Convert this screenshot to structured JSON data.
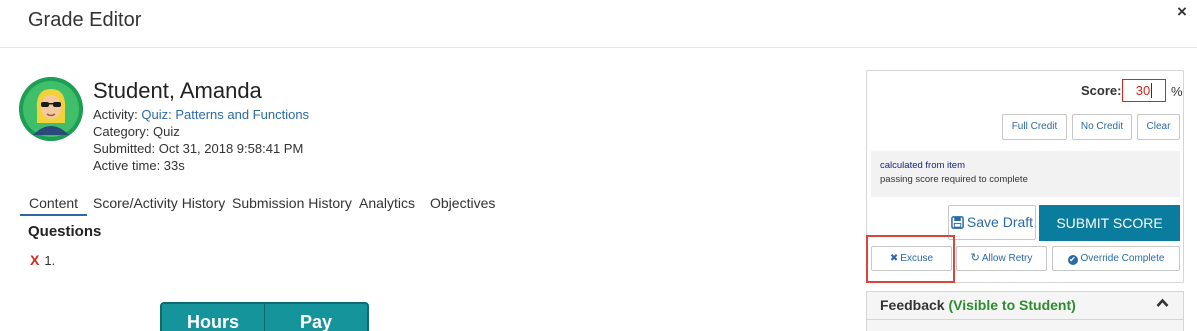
{
  "modal": {
    "title": "Grade Editor",
    "close_glyph": "×"
  },
  "student": {
    "name": "Student, Amanda",
    "activity_label": "Activity: ",
    "activity_link": "Quiz: Patterns and Functions",
    "category": "Category: Quiz",
    "submitted": "Submitted: Oct 31, 2018 9:58:41 PM",
    "active_time": "Active time: 33s"
  },
  "tabs": [
    {
      "label": "Content",
      "active": true
    },
    {
      "label": "Score/Activity History",
      "active": false
    },
    {
      "label": "Submission History",
      "active": false
    },
    {
      "label": "Analytics",
      "active": false
    },
    {
      "label": "Objectives",
      "active": false
    }
  ],
  "content": {
    "questions_title": "Questions",
    "question_mark": "X",
    "question_number": "1.",
    "table_headers": [
      "Hours",
      "Pay"
    ]
  },
  "score_panel": {
    "score_label": "Score:",
    "score_value": "30",
    "percent_sign": "%",
    "full_credit": "Full Credit",
    "no_credit": "No Credit",
    "clear": "Clear",
    "info_line1": "calculated from item",
    "info_line2": "passing score required to complete",
    "save_draft": "Save Draft",
    "submit_score": "SUBMIT SCORE",
    "excuse": "Excuse",
    "allow_retry": "Allow Retry",
    "override_complete": "Override Complete"
  },
  "feedback": {
    "title": "Feedback",
    "visibility": "(Visible to Student)"
  },
  "colors": {
    "link": "#2b6aa6",
    "submit_bg": "#0a7d9e",
    "error_red": "#d9261c",
    "avatar_green": "#1e9e54",
    "table_teal": "#16949c",
    "visible_green": "#2e8b2e"
  },
  "icons": [
    "close-icon",
    "avatar-icon",
    "x-mark-icon",
    "save-icon",
    "times-icon",
    "refresh-icon",
    "check-circle-icon",
    "chevron-up-icon"
  ]
}
